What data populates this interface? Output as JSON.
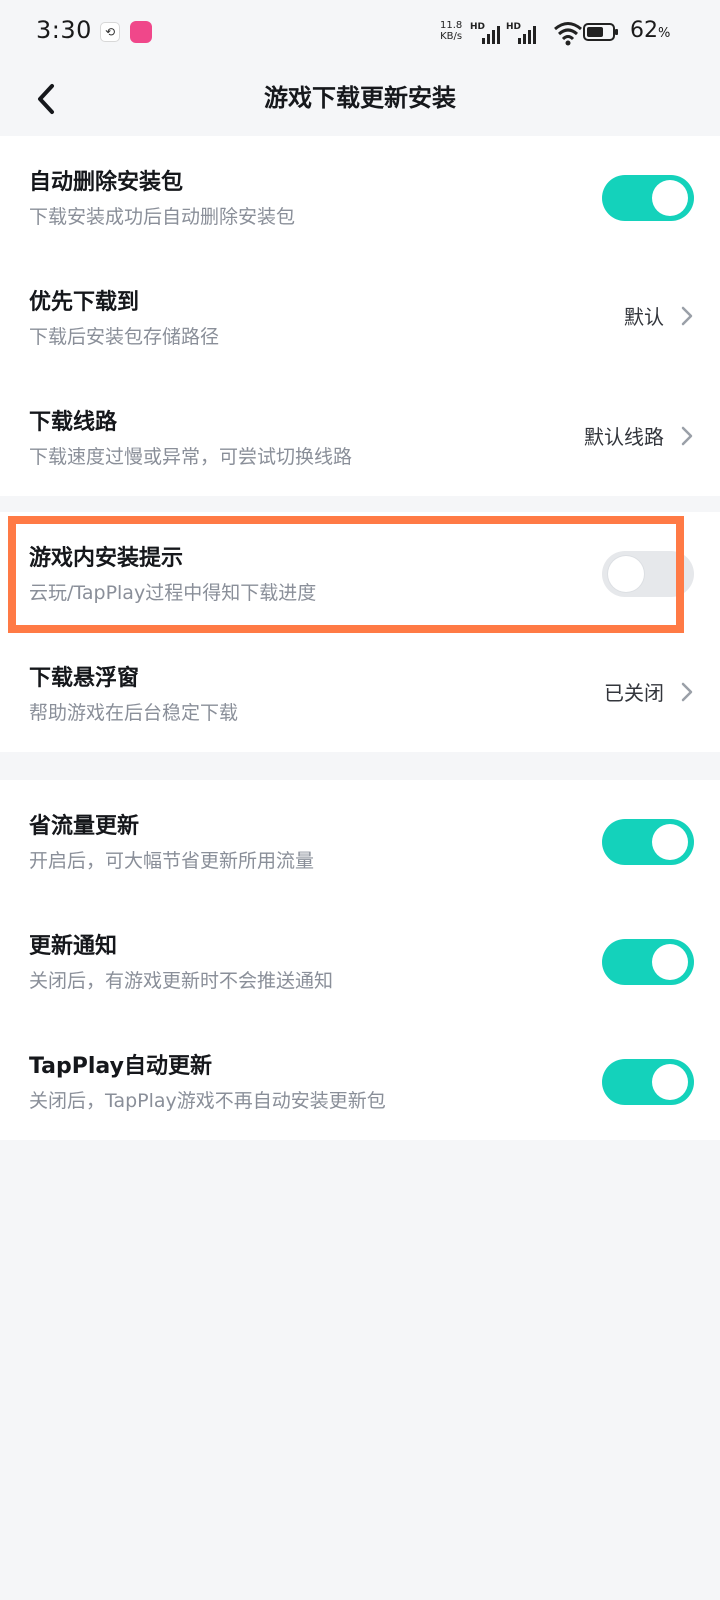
{
  "status_bar": {
    "time": "3:30",
    "network_speed_value": "11.8",
    "network_speed_unit": "KB/s",
    "signal_label": "HD",
    "battery_percent": "62",
    "battery_symbol": "%"
  },
  "header": {
    "title": "游戏下载更新安装"
  },
  "sections": [
    {
      "items": [
        {
          "title": "自动删除安装包",
          "subtitle": "下载安装成功后自动删除安装包",
          "control": "toggle",
          "on": true
        },
        {
          "title": "优先下载到",
          "subtitle": "下载后安装包存储路径",
          "control": "value",
          "value": "默认"
        },
        {
          "title": "下载线路",
          "subtitle": "下载速度过慢或异常，可尝试切换线路",
          "control": "value",
          "value": "默认线路"
        }
      ]
    },
    {
      "items": [
        {
          "title": "游戏内安装提示",
          "subtitle": "云玩/TapPlay过程中得知下载进度",
          "control": "toggle",
          "on": false
        },
        {
          "title": "下载悬浮窗",
          "subtitle": "帮助游戏在后台稳定下载",
          "control": "value",
          "value": "已关闭"
        }
      ]
    },
    {
      "items": [
        {
          "title": "省流量更新",
          "subtitle": "开启后，可大幅节省更新所用流量",
          "control": "toggle",
          "on": true
        },
        {
          "title": "更新通知",
          "subtitle": "关闭后，有游戏更新时不会推送通知",
          "control": "toggle",
          "on": true
        },
        {
          "title": "TapPlay自动更新",
          "subtitle": "关闭后，TapPlay游戏不再自动安装更新包",
          "control": "toggle",
          "on": true
        }
      ]
    }
  ],
  "colors": {
    "accent": "#14d2bb",
    "toggle_off": "#e6e8eb",
    "highlight_border": "#ff7a45",
    "page_background": "#f5f6f8"
  },
  "icons": {
    "back": "chevron-left-icon",
    "row_arrow": "chevron-right-icon"
  }
}
